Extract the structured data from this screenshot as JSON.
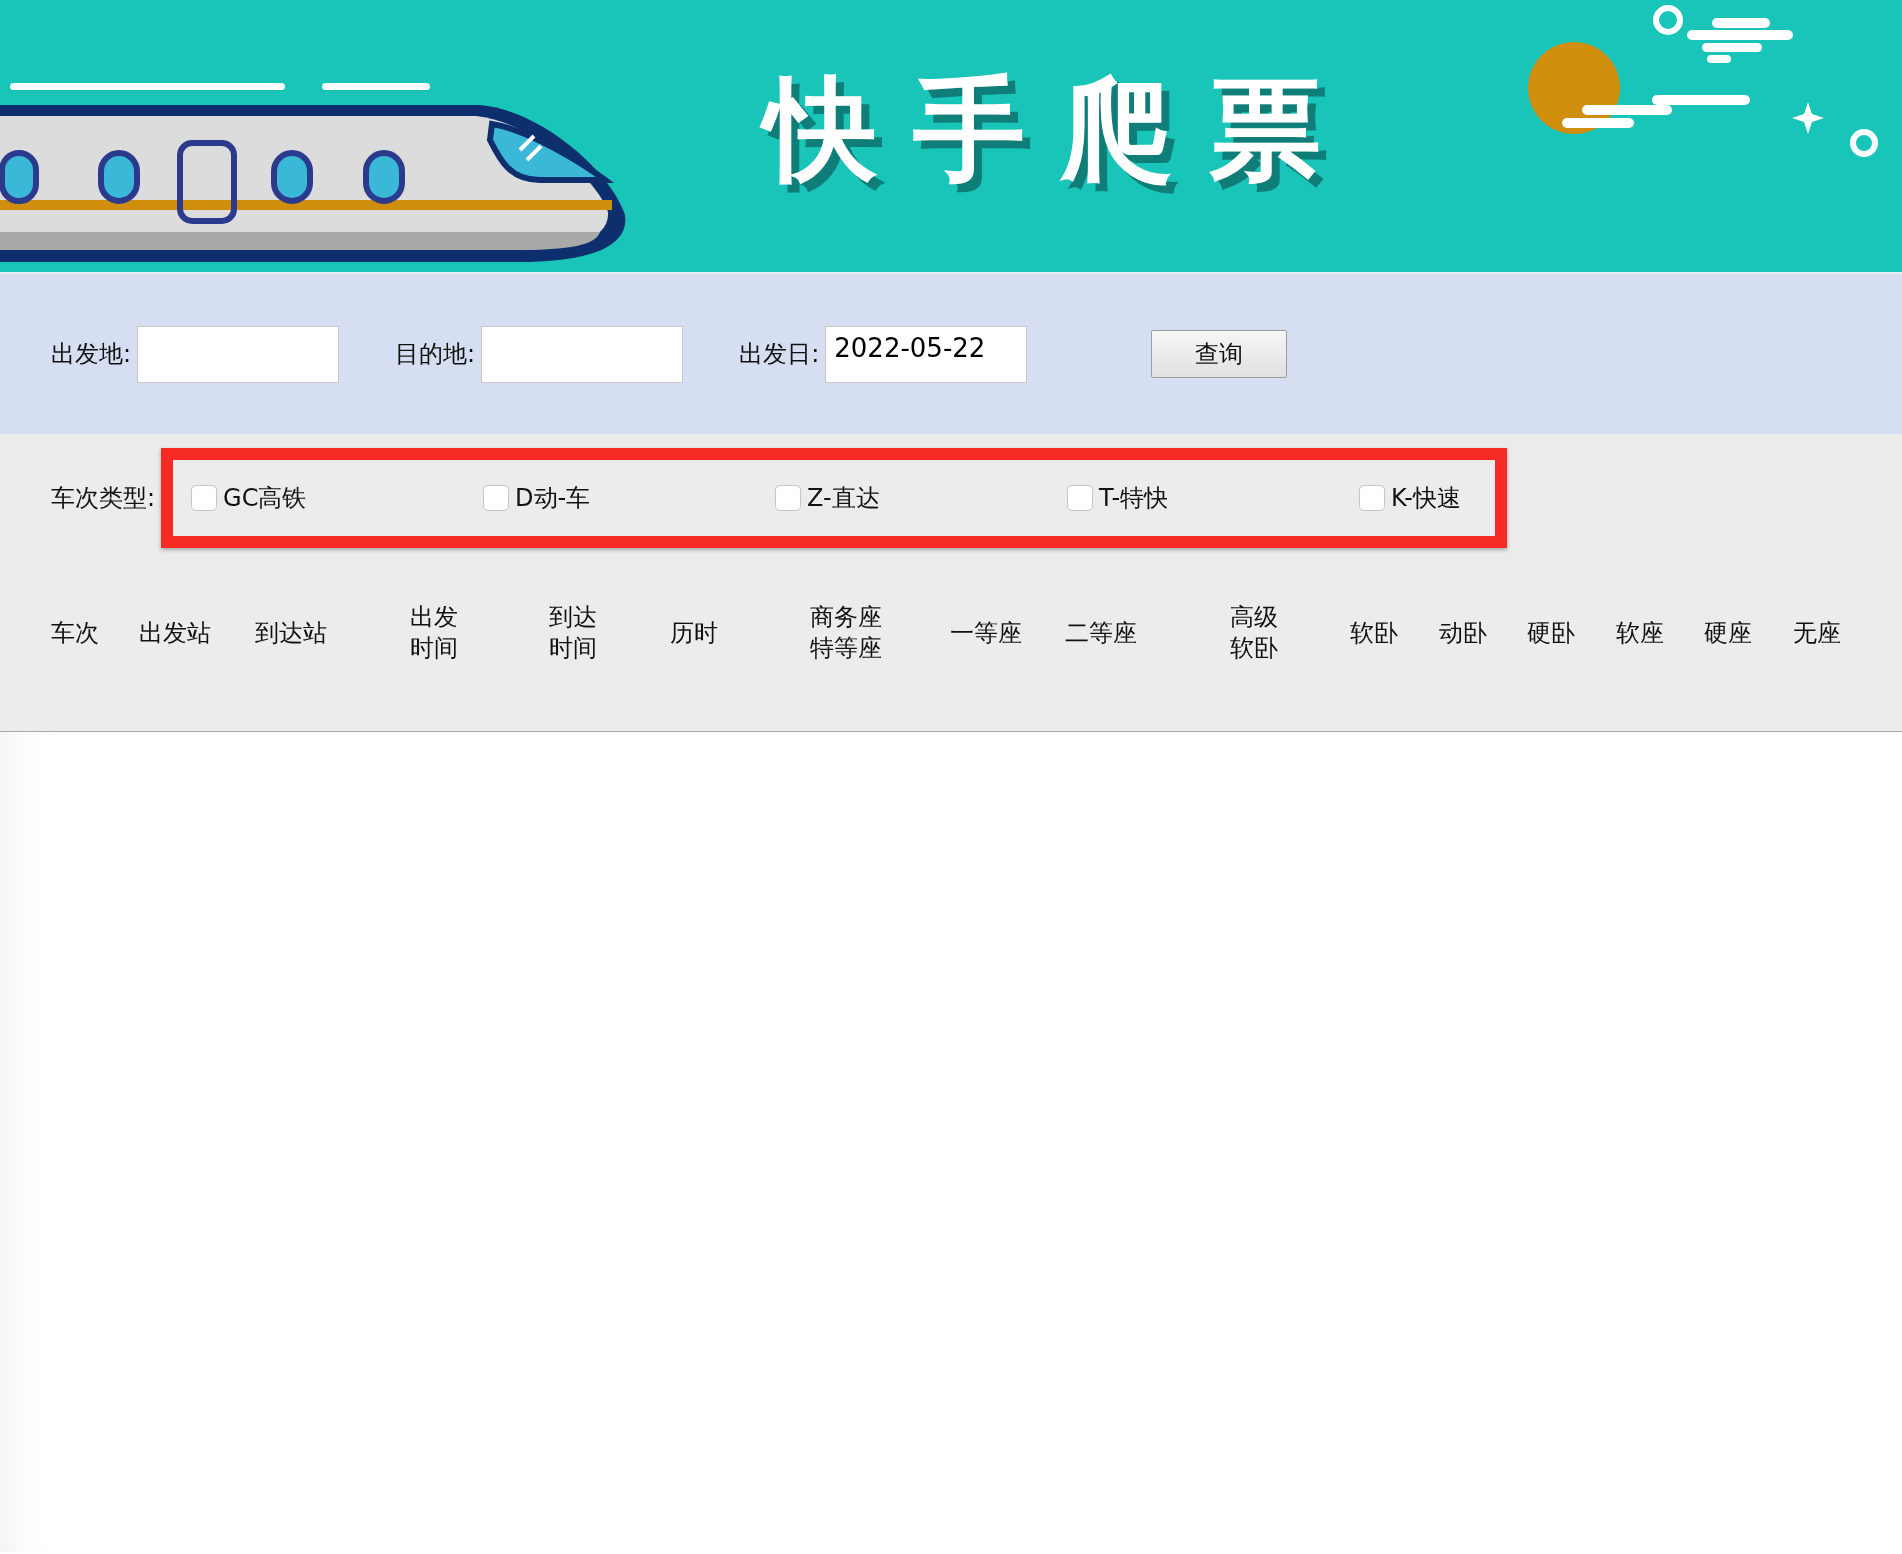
{
  "banner": {
    "title": "快手爬票"
  },
  "search_form": {
    "fields": [
      {
        "label": "出发地:"
      },
      {
        "label": "目的地:"
      },
      {
        "label": "出发日:",
        "value": "2022-05-22"
      }
    ],
    "button": "查询"
  },
  "train_types": {
    "label": "车次类型:",
    "highlighted": true,
    "options": [
      {
        "label": "GC高铁",
        "checked": false
      },
      {
        "label": "D动-车",
        "checked": false
      },
      {
        "label": "Z-直达",
        "checked": false
      },
      {
        "label": "T-特快",
        "checked": false
      },
      {
        "label": "K-快速",
        "checked": false
      }
    ]
  },
  "table": {
    "columns": [
      "车次",
      "出发站",
      "到达站",
      "出发时间",
      "到达时间",
      "历时",
      "商务座特等座",
      "一等座",
      "二等座",
      "高级软卧",
      "软卧",
      "动卧",
      "硬卧",
      "软座",
      "硬座",
      "无座"
    ]
  }
}
